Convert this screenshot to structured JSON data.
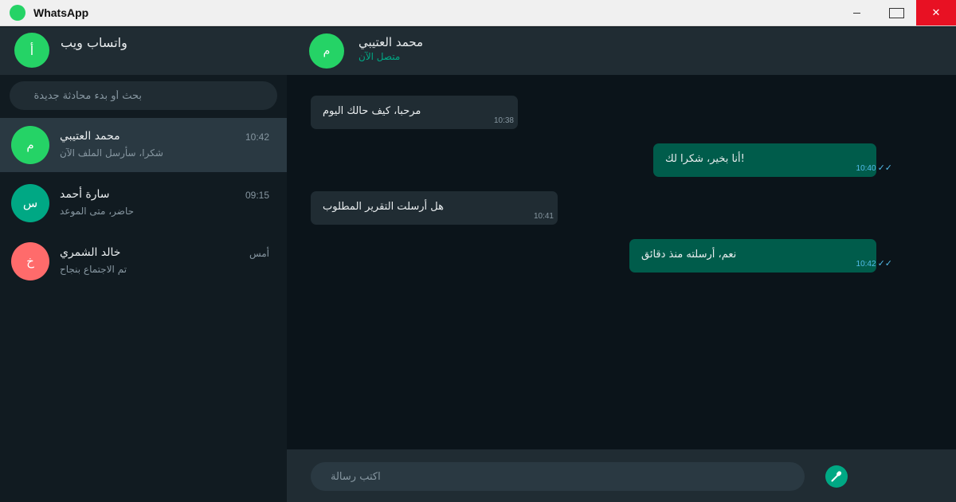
{
  "window": {
    "title": "WhatsApp",
    "minimize_icon": "minimize-icon",
    "maximize_icon": "maximize-icon",
    "close_label": "✕"
  },
  "sidebar": {
    "profile_initial": "أ",
    "title": "واتساب ويب",
    "search_placeholder": "بحث أو بدء محادثة جديدة",
    "chats": [
      {
        "initial": "م",
        "name": "محمد العتيبي",
        "preview": "شكرا، سأرسل الملف الآن",
        "time": "10:42",
        "color": "#25d366",
        "active": true
      },
      {
        "initial": "س",
        "name": "سارة أحمد",
        "preview": "حاضر، متى الموعد",
        "time": "09:15",
        "color": "#00a884",
        "active": false
      },
      {
        "initial": "خ",
        "name": "خالد الشمري",
        "preview": "تم الاجتماع بنجاح",
        "time": "أمس",
        "color": "#ff6b6b",
        "active": false
      }
    ]
  },
  "conversation": {
    "initial": "م",
    "name": "محمد العتيبي",
    "status": "متصل الآن",
    "messages": [
      {
        "direction": "in",
        "text": "مرحبا، كيف حالك اليوم",
        "time": "10:38"
      },
      {
        "direction": "out",
        "text": "أنا بخير، شكرا لك!",
        "time": "10:40",
        "ticks": "✓✓"
      },
      {
        "direction": "in",
        "text": "هل أرسلت التقرير المطلوب",
        "time": "10:41"
      },
      {
        "direction": "out",
        "text": "نعم، أرسلته منذ دقائق",
        "time": "10:42",
        "ticks": "✓✓"
      }
    ],
    "input_placeholder": "اكتب رسالة",
    "send_icon": "microphone-icon"
  },
  "colors": {
    "accent": "#00a884",
    "brand": "#25d366",
    "panel": "#202c33",
    "background": "#0b141a",
    "outgoing_bubble": "#005c4b",
    "close_button": "#e81123"
  }
}
